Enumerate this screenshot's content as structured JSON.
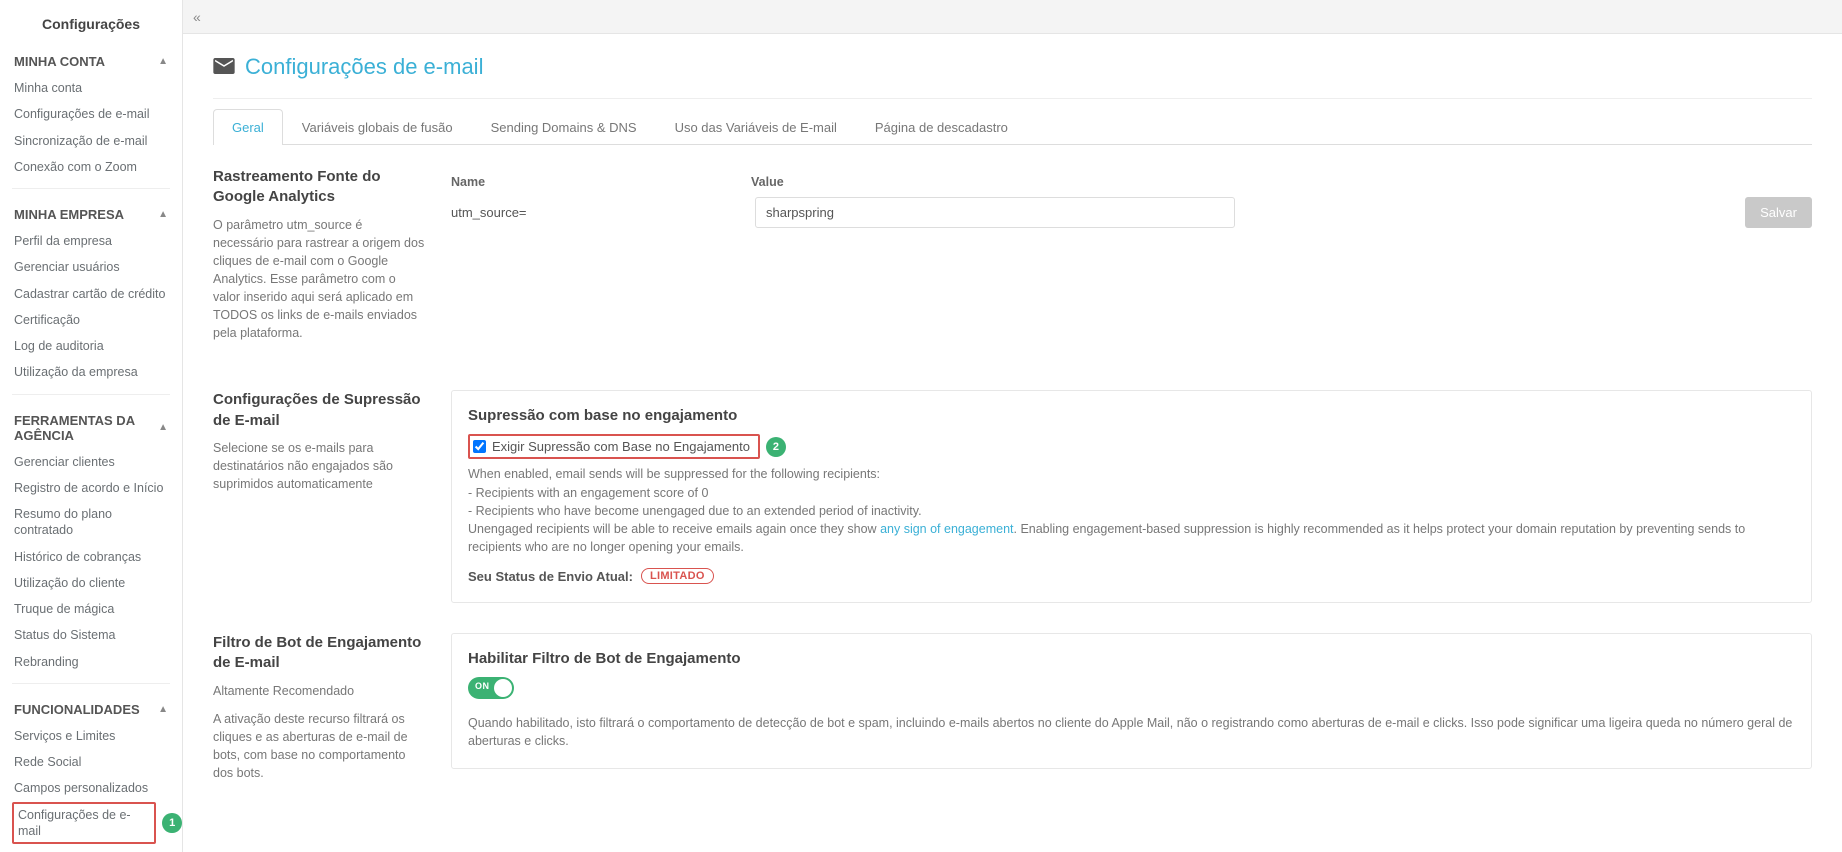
{
  "sidebar": {
    "title": "Configurações",
    "sections": [
      {
        "label": "MINHA CONTA",
        "items": [
          "Minha conta",
          "Configurações de e-mail",
          "Sincronização de e-mail",
          "Conexão com o Zoom"
        ]
      },
      {
        "label": "MINHA EMPRESA",
        "items": [
          "Perfil da empresa",
          "Gerenciar usuários",
          "Cadastrar cartão de crédito",
          "Certificação",
          "Log de auditoria",
          "Utilização da empresa"
        ]
      },
      {
        "label": "FERRAMENTAS DA AGÊNCIA",
        "items": [
          "Gerenciar clientes",
          "Registro de acordo e Início",
          "Resumo do plano contratado",
          "Histórico de cobranças",
          "Utilização do cliente",
          "Truque de mágica",
          "Status do Sistema",
          "Rebranding"
        ]
      },
      {
        "label": "FUNCIONALIDADES",
        "items": [
          "Serviços e Limites",
          "Rede Social",
          "Campos personalizados",
          "Configurações de e-mail"
        ]
      }
    ]
  },
  "page": {
    "title": "Configurações de e-mail"
  },
  "tabs": [
    "Geral",
    "Variáveis globais de fusão",
    "Sending Domains & DNS",
    "Uso das Variáveis de E-mail",
    "Página de descadastro"
  ],
  "ga": {
    "heading": "Rastreamento Fonte do Google Analytics",
    "desc": "O parâmetro utm_source é necessário para rastrear a origem dos cliques de e-mail com o Google Analytics. Esse parâmetro com o valor inserido aqui será aplicado em TODOS os links de e-mails enviados pela plataforma.",
    "col_name": "Name",
    "col_value": "Value",
    "param": "utm_source=",
    "value": "sharpspring",
    "save": "Salvar"
  },
  "suppress": {
    "left_heading": "Configurações de Supressão de E-mail",
    "left_desc": "Selecione se os e-mails para destinatários não engajados são suprimidos automaticamente",
    "panel_heading": "Supressão com base no engajamento",
    "checkbox": "Exigir Supressão com Base no Engajamento",
    "d1": "When enabled, email sends will be suppressed for the following recipients:",
    "d2": "- Recipients with an engagement score of 0",
    "d3": "- Recipients who have become unengaged due to an extended period of inactivity.",
    "d4a": "Unengaged recipients will be able to receive emails again once they show ",
    "d4link": "any sign of engagement",
    "d4b": ". Enabling engagement-based suppression is highly recommended as it helps protect your domain reputation by preventing sends to recipients who are no longer opening your emails.",
    "status_label": "Seu Status de Envio Atual:",
    "status_value": "LIMITADO",
    "badge": "2"
  },
  "botfilter": {
    "left_heading": "Filtro de Bot de Engajamento de E-mail",
    "left_sub": "Altamente Recomendado",
    "left_desc": "A ativação deste recurso filtrará os cliques e as aberturas de e-mail de bots, com base no comportamento dos bots.",
    "panel_heading": "Habilitar Filtro de Bot de Engajamento",
    "toggle": "ON",
    "desc": "Quando habilitado, isto filtrará o comportamento de detecção de bot e spam, incluindo e-mails abertos no cliente do Apple Mail, não o registrando como aberturas de e-mail e clicks. Isso pode significar uma ligeira queda no número geral de aberturas e clicks."
  },
  "badge1": "1"
}
